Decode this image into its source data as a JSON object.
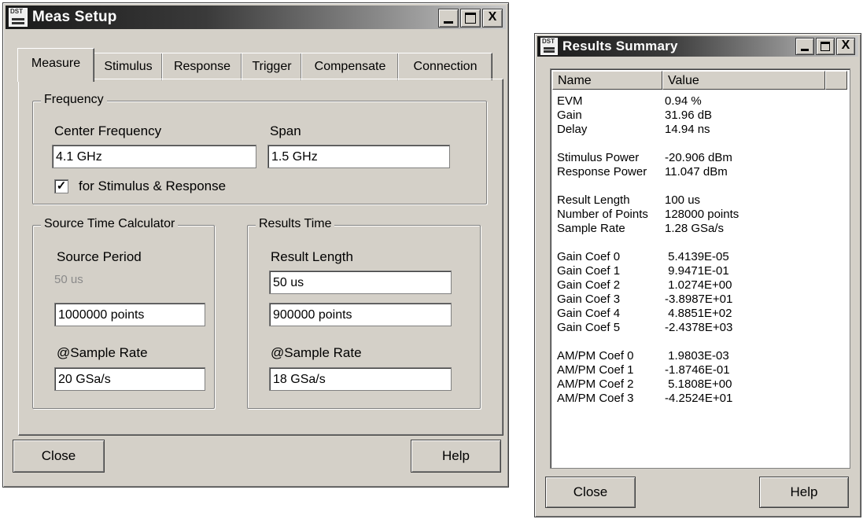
{
  "meas_setup": {
    "title": "Meas Setup",
    "tabs": [
      "Measure",
      "Stimulus",
      "Response",
      "Trigger",
      "Compensate",
      "Connection"
    ],
    "frequency": {
      "legend": "Frequency",
      "center_label": "Center Frequency",
      "center_value": "4.1 GHz",
      "span_label": "Span",
      "span_value": "1.5 GHz",
      "checkbox_label": "for Stimulus & Response",
      "checkbox_checked": true
    },
    "source_time": {
      "legend": "Source Time Calculator",
      "period_label": "Source Period",
      "period_value": "50 us",
      "points_value": "1000000 points",
      "rate_label": "@Sample Rate",
      "rate_value": "20 GSa/s"
    },
    "results_time": {
      "legend": "Results Time",
      "length_label": "Result Length",
      "length_value": "50 us",
      "points_value": "900000 points",
      "rate_label": "@Sample Rate",
      "rate_value": "18 GSa/s"
    },
    "close_label": "Close",
    "help_label": "Help"
  },
  "results_summary": {
    "title": "Results Summary",
    "col_name": "Name",
    "col_value": "Value",
    "rows": [
      {
        "name": "EVM",
        "value": "0.94 %"
      },
      {
        "name": "Gain",
        "value": "31.96 dB"
      },
      {
        "name": "Delay",
        "value": "14.94 ns"
      },
      {
        "name": "",
        "value": ""
      },
      {
        "name": "Stimulus Power",
        "value": "-20.906 dBm"
      },
      {
        "name": "Response Power",
        "value": "11.047 dBm"
      },
      {
        "name": "",
        "value": ""
      },
      {
        "name": "Result Length",
        "value": "100 us"
      },
      {
        "name": "Number of Points",
        "value": "128000 points"
      },
      {
        "name": "Sample Rate",
        "value": "1.28 GSa/s"
      },
      {
        "name": "",
        "value": ""
      },
      {
        "name": "Gain Coef 0",
        "value": " 5.4139E-05"
      },
      {
        "name": "Gain Coef 1",
        "value": " 9.9471E-01"
      },
      {
        "name": "Gain Coef 2",
        "value": " 1.0274E+00"
      },
      {
        "name": "Gain Coef 3",
        "value": "-3.8987E+01"
      },
      {
        "name": "Gain Coef 4",
        "value": " 4.8851E+02"
      },
      {
        "name": "Gain Coef 5",
        "value": "-2.4378E+03"
      },
      {
        "name": "",
        "value": ""
      },
      {
        "name": "AM/PM Coef 0",
        "value": " 1.9803E-03"
      },
      {
        "name": "AM/PM Coef 1",
        "value": "-1.8746E-01"
      },
      {
        "name": "AM/PM Coef 2",
        "value": " 5.1808E+00"
      },
      {
        "name": "AM/PM Coef 3",
        "value": "-4.2524E+01"
      }
    ],
    "close_label": "Close",
    "help_label": "Help"
  },
  "app_icon_text": "DST",
  "close_glyph": "X"
}
